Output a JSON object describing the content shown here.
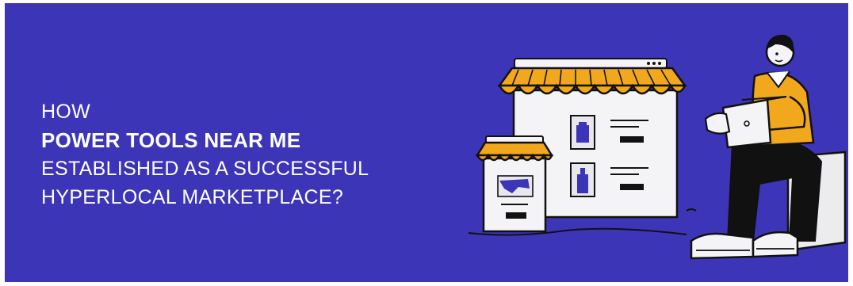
{
  "banner": {
    "background_color": "#3d35b8",
    "accent_color": "#f2a81d",
    "headline": {
      "line1": "HOW",
      "line2": "POWER TOOLS NEAR ME",
      "line3": "ESTABLISHED AS A SUCCESSFUL",
      "line4": "HYPERLOCAL MARKETPLACE?"
    },
    "illustration": {
      "icons": [
        "storefront-icon",
        "small-shop-icon",
        "person-with-laptop-icon",
        "cushion-icon"
      ]
    }
  }
}
